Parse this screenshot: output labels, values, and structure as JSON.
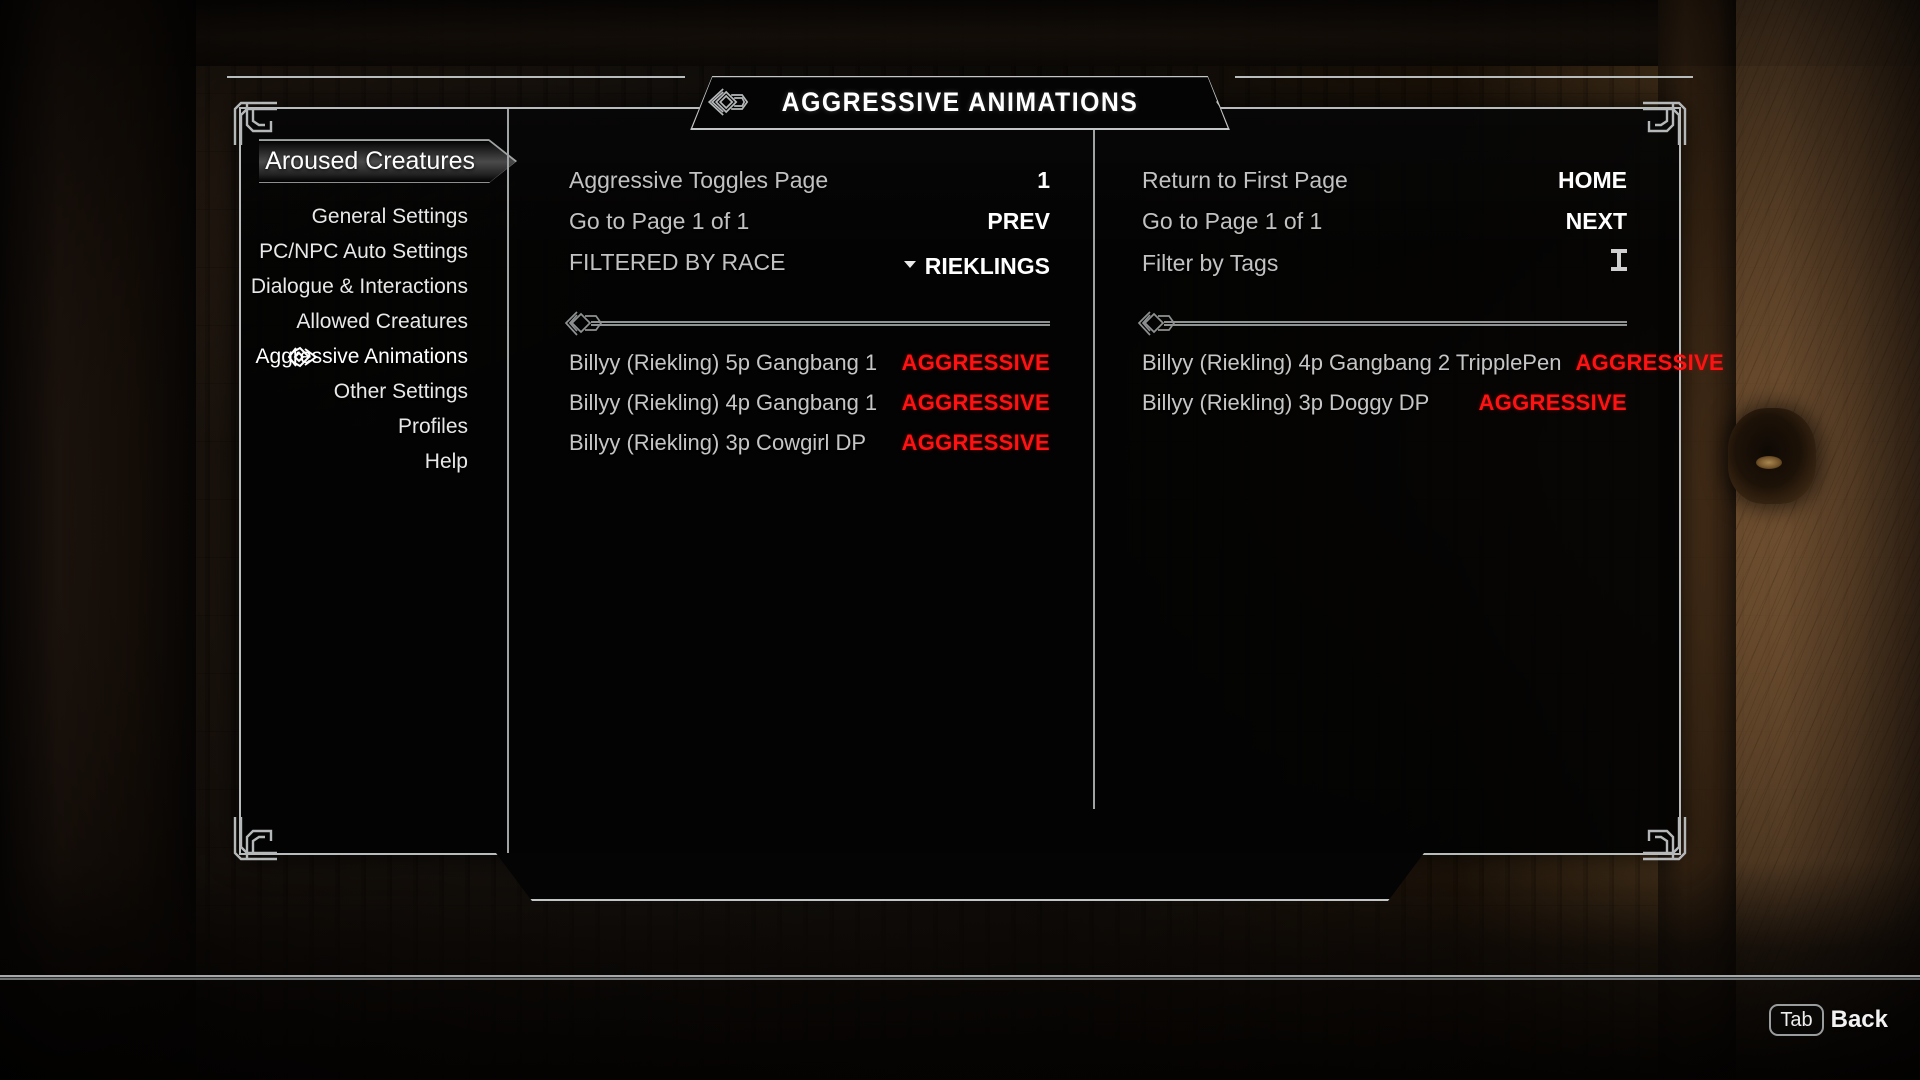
{
  "window": {
    "title": "AGGRESSIVE ANIMATIONS"
  },
  "sidebar": {
    "mod_name": "Aroused Creatures",
    "items": [
      {
        "label": "General Settings",
        "selected": false
      },
      {
        "label": "PC/NPC Auto Settings",
        "selected": false
      },
      {
        "label": "Dialogue & Interactions",
        "selected": false
      },
      {
        "label": "Allowed Creatures",
        "selected": false
      },
      {
        "label": "Aggressive Animations",
        "selected": true
      },
      {
        "label": "Other Settings",
        "selected": false
      },
      {
        "label": "Profiles",
        "selected": false
      },
      {
        "label": "Help",
        "selected": false
      }
    ]
  },
  "left_column": {
    "options": [
      {
        "label": "Aggressive Toggles Page",
        "value": "1",
        "control": "text"
      },
      {
        "label": "Go to Page 1 of 1",
        "value": "PREV",
        "control": "text"
      },
      {
        "label": "FILTERED BY RACE",
        "value": "RIEKLINGS",
        "control": "dropdown"
      }
    ],
    "animations": [
      {
        "name": "Billyy (Riekling) 5p Gangbang 1",
        "state": "AGGRESSIVE"
      },
      {
        "name": "Billyy (Riekling) 4p Gangbang 1",
        "state": "AGGRESSIVE"
      },
      {
        "name": "Billyy (Riekling) 3p Cowgirl DP",
        "state": "AGGRESSIVE"
      }
    ]
  },
  "right_column": {
    "options": [
      {
        "label": "Return to First Page",
        "value": "HOME",
        "control": "text"
      },
      {
        "label": "Go to Page 1 of 1",
        "value": "NEXT",
        "control": "text"
      },
      {
        "label": "Filter by Tags",
        "value": "",
        "control": "text-input-cursor"
      }
    ],
    "animations": [
      {
        "name": "Billyy (Riekling) 4p Gangbang 2 TripplePen",
        "state": "AGGRESSIVE",
        "overlapping": true
      },
      {
        "name": "Billyy (Riekling) 3p Doggy DP",
        "state": "AGGRESSIVE",
        "overlapping": false
      }
    ]
  },
  "hud": {
    "back_key": "Tab",
    "back_label": "Back"
  },
  "colors": {
    "frame": "#b9bcbd",
    "text_primary": "#ffffff",
    "text_secondary": "#c2c2c2",
    "state_aggressive": "#ff1212",
    "panel_bg": "#030303"
  }
}
